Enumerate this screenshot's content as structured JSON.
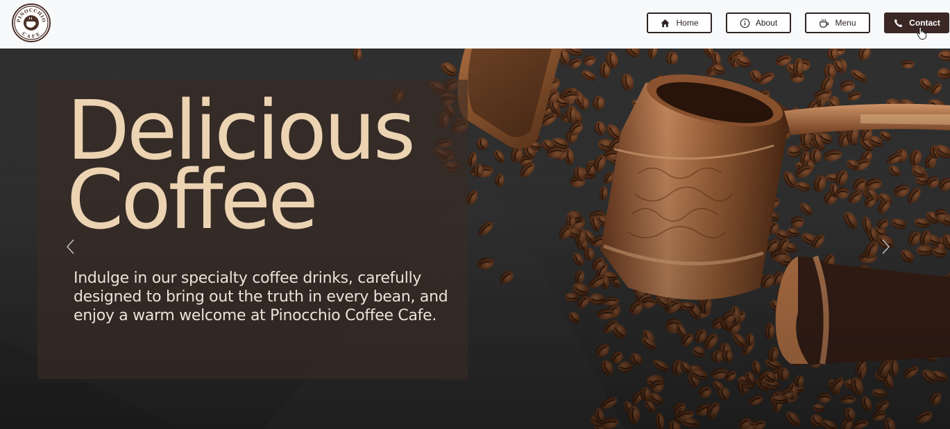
{
  "header": {
    "logo": {
      "icon": "coffee-cup-logo-icon",
      "top_text": "PINOCCHIO",
      "bottom_text": "CAFE"
    },
    "nav": [
      {
        "label": "Home",
        "icon": "home-icon"
      },
      {
        "label": "About",
        "icon": "info-icon"
      },
      {
        "label": "Menu",
        "icon": "coffee-cup-icon"
      },
      {
        "label": "Contact",
        "icon": "phone-icon",
        "active": true
      }
    ]
  },
  "hero": {
    "headline_line1": "Delicious",
    "headline_line2": "Coffee",
    "tagline": "Indulge in our specialty coffee drinks, carefully designed to bring out the truth in every bean, and enjoy a warm welcome at Pinocchio Coffee Cafe.",
    "prev_icon": "chevron-left-icon",
    "next_icon": "chevron-right-icon"
  },
  "colors": {
    "header_bg": "#f8f9fb",
    "nav_border": "#2e2321",
    "nav_active_bg": "#3b2825",
    "headline": "#ecd3b2",
    "tagline": "#ece3d8",
    "hero_bg": "#303030"
  }
}
